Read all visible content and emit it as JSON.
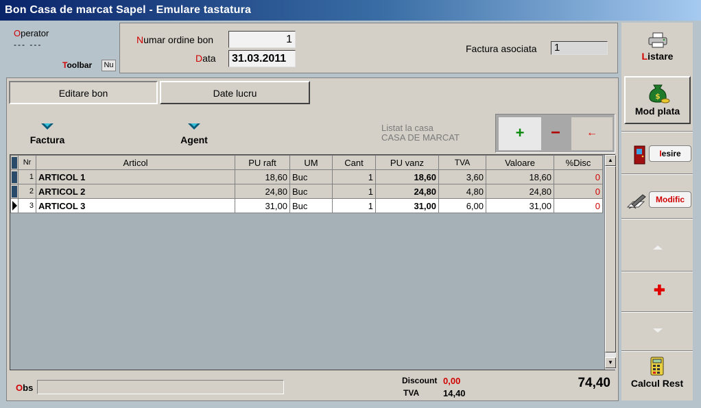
{
  "window": {
    "title": "Bon Casa de marcat Sapel - Emulare tastatura"
  },
  "operator": {
    "label_hk": "O",
    "label_rest": "perator",
    "value": "--- ---"
  },
  "toolbar": {
    "label_hk": "T",
    "label_rest": "oolbar",
    "value": "Nu"
  },
  "header": {
    "numar_hk": "N",
    "numar_rest": "umar ordine bon",
    "numar_value": "1",
    "data_hk": "D",
    "data_rest": "ata",
    "data_value": "31.03.2011",
    "factura_label": "Factura asociata",
    "factura_value": "1"
  },
  "tabs": [
    {
      "label": "Editare bon",
      "active": true
    },
    {
      "label": "Date lucru",
      "active": false
    }
  ],
  "buttons": {
    "factura": "Factura",
    "agent": "Agent"
  },
  "listat": {
    "line1": "Listat la casa",
    "line2": "CASA DE MARCAT"
  },
  "toolbox": {
    "add": "+",
    "remove": "−",
    "back": "←"
  },
  "grid": {
    "columns": [
      "Nr",
      "Articol",
      "PU raft",
      "UM",
      "Cant",
      "PU vanz",
      "TVA",
      "Valoare",
      "%Disc"
    ],
    "rows": [
      {
        "nr": "1",
        "articol": "ARTICOL 1",
        "pu_raft": "18,60",
        "um": "Buc",
        "cant": "1",
        "pu_vanz": "18,60",
        "tva": "3,60",
        "valoare": "18,60",
        "disc": "0"
      },
      {
        "nr": "2",
        "articol": "ARTICOL 2",
        "pu_raft": "24,80",
        "um": "Buc",
        "cant": "1",
        "pu_vanz": "24,80",
        "tva": "4,80",
        "valoare": "24,80",
        "disc": "0"
      },
      {
        "nr": "3",
        "articol": "ARTICOL 3",
        "pu_raft": "31,00",
        "um": "Buc",
        "cant": "1",
        "pu_vanz": "31,00",
        "tva": "6,00",
        "valoare": "31,00",
        "disc": "0"
      }
    ]
  },
  "footer": {
    "obs_hk": "O",
    "obs_rest": "bs",
    "discount_label": "Discount",
    "discount_value": "0,00",
    "tva_label": "TVA",
    "tva_value": "14,40",
    "total": "74,40"
  },
  "sidebar": {
    "listare_hk": "L",
    "listare_rest": "istare",
    "mod_plata": "Mod plata",
    "iesire_hk": "I",
    "iesire_rest": "esire",
    "modific_hk": "M",
    "modific_rest": "odific",
    "calcul_rest": "Calcul Rest"
  },
  "colors": {
    "title_start": "#0a246a",
    "title_end": "#a6caf0",
    "hotkey": "#d00000",
    "window_bg": "#b7c3cb",
    "panel_bg": "#d4d0c8"
  },
  "icons": [
    "printer-icon",
    "money-bag-icon",
    "door-exit-icon",
    "pen-edit-icon",
    "arrow-up-icon",
    "plus-icon",
    "arrow-down-icon",
    "calculator-icon",
    "triangle-down-icon",
    "row-pointer-icon"
  ]
}
